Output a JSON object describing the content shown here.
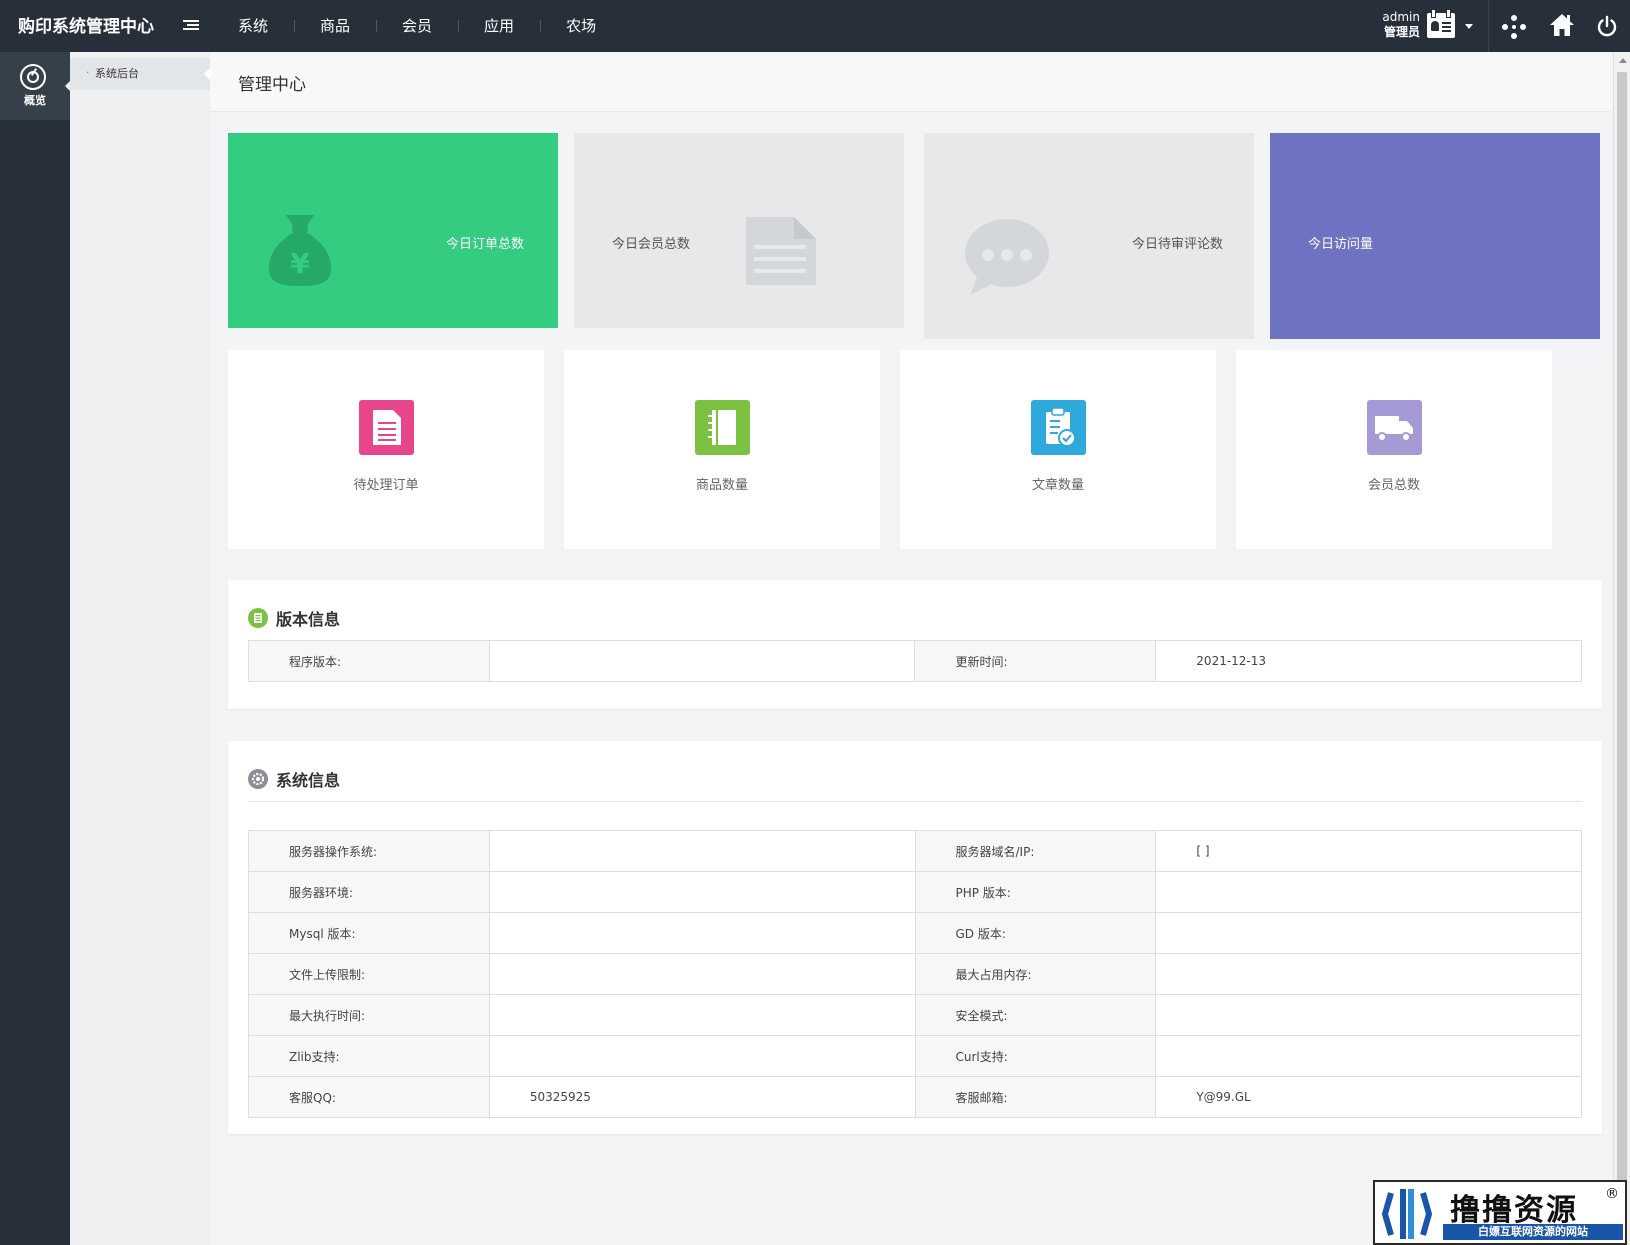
{
  "header": {
    "brand": "购印系统管理中心",
    "nav": [
      "系统",
      "商品",
      "会员",
      "应用",
      "农场"
    ],
    "admin_name": "admin",
    "admin_role": "管理员"
  },
  "rail": {
    "items": [
      {
        "label": "概览",
        "icon": "dashboard-icon"
      }
    ]
  },
  "subnav": {
    "items": [
      {
        "label": "系统后台"
      }
    ]
  },
  "page": {
    "title": "管理中心"
  },
  "stats": [
    {
      "label": "今日订单总数",
      "color": "#33cc80",
      "icon": "money-bag-icon"
    },
    {
      "label": "今日会员总数",
      "color": "#e6e8ea",
      "icon": "document-icon"
    },
    {
      "label": "今日待审评论数",
      "color": "#e6e8ea",
      "icon": "chat-bubble-icon"
    },
    {
      "label": "今日访问量",
      "color": "#6e72c2",
      "icon": "visit-icon"
    }
  ],
  "quick": [
    {
      "label": "待处理订单",
      "color": "#e8468a",
      "icon": "order-doc-icon"
    },
    {
      "label": "商品数量",
      "color": "#7cc142",
      "icon": "notebook-icon"
    },
    {
      "label": "文章数量",
      "color": "#2fa8dc",
      "icon": "clipboard-check-icon"
    },
    {
      "label": "会员总数",
      "color": "#a69ad6",
      "icon": "truck-icon"
    }
  ],
  "version": {
    "title": "版本信息",
    "rows": [
      {
        "k1": "程序版本:",
        "v1": "",
        "k2": "更新时间:",
        "v2": "2021-12-13"
      }
    ]
  },
  "system": {
    "title": "系统信息",
    "rows": [
      {
        "k1": "服务器操作系统:",
        "v1": "",
        "k2": "服务器域名/IP:",
        "v2": "[ ]"
      },
      {
        "k1": "服务器环境:",
        "v1": "",
        "k2": "PHP 版本:",
        "v2": ""
      },
      {
        "k1": "Mysql 版本:",
        "v1": "",
        "k2": "GD 版本:",
        "v2": ""
      },
      {
        "k1": "文件上传限制:",
        "v1": "",
        "k2": "最大占用内存:",
        "v2": ""
      },
      {
        "k1": "最大执行时间:",
        "v1": "",
        "k2": "安全模式:",
        "v2": ""
      },
      {
        "k1": "Zlib支持:",
        "v1": "",
        "k2": "Curl支持:",
        "v2": ""
      },
      {
        "k1": "客服QQ:",
        "v1": "50325925",
        "k2": "客服邮箱:",
        "v2": "Y@99.GL"
      }
    ]
  },
  "watermark": {
    "title": "撸撸资源",
    "reg": "®",
    "subtitle": "白嫖互联网资源的网站"
  }
}
